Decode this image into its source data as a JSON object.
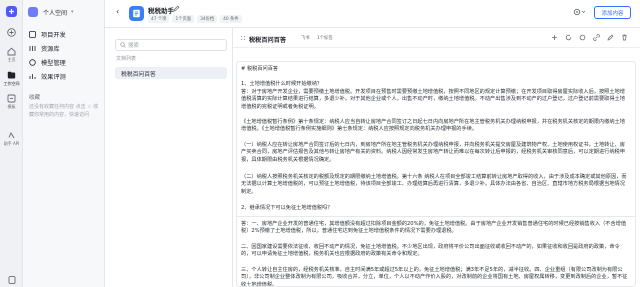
{
  "rail": {
    "items": [
      {
        "icon": "new-icon",
        "label": ""
      },
      {
        "icon": "home-icon",
        "label": "主页"
      },
      {
        "icon": "workspace-icon",
        "label": "工作空间"
      },
      {
        "icon": "settings-icon",
        "label": "模板"
      },
      {
        "icon": "chat-icon",
        "label": "助手 API"
      }
    ]
  },
  "sidebar": {
    "workspace": "个人空间",
    "items": [
      {
        "label": "项目开发"
      },
      {
        "label": "资源库"
      },
      {
        "label": "模型管理"
      },
      {
        "label": "效果评测"
      }
    ],
    "section": "收藏",
    "empty_text": "还没有收藏任何内容 点击 ☆ 收藏你常用的内容，快速访问"
  },
  "header": {
    "title": "税税助手",
    "meta": [
      "47 个项",
      "1个页面",
      "34份档",
      "40 条件"
    ],
    "add_button": "添加内容"
  },
  "filepanel": {
    "search_placeholder": "搜索",
    "list_label": "文档列表",
    "file": "税税百问百答"
  },
  "doc": {
    "title": "税税百问百答",
    "tags": [
      "飞书",
      "1个标签"
    ],
    "paragraphs": [
      "# 税税百问百答",
      "1、土地增值税什么时候开始缴纳？",
      "答：对于房地产开发企业，需要预缴土地增值税。开发项目在预售时需要预缴土地增值税，按照不同地区的规定计算预缴；在开发项目取得房屋实际收入后，按照土地增值税清算的实际计算结果进行结算，多退少补。对于其他企业或个人，出售不动产时，缴纳土地增值税。不动产出售涉及到不动产的过户登记，过户登记前需要取得土地增值税的完税证明或者免税证明。",
      "《土地增值税暂行条例》第十条规定：纳税人应当自转让房地产合同签订之日起七日内向房地产所在地主管税务机关办理纳税申报，并在税务机关核定的期限内缴纳土地增值税。《土地增值税暂行条例实施细则》第七条规定：纳税人应按照规定向税务机关办理申报的手续。",
      "（一）纳税人应在转让房地产合同签订后的七日内，到房地产所在地主管税务机关办理纳税申报，并向税务机关提交房屋及建筑物产权、土地使用权证书，土地转让、房产买卖合同，房地产评估报告及其他与转让房地产有关的资料。纳税人因经常发生房地产转让而难以在每次转让后申报的，经税务机关审核同意后，可以定期进行纳税申报，具体期限由税务机关根据情况确定。",
      "（二）纳税人按照税务机关核定的税额及规定的期限缴纳土地增值税。第十六条 纳税人在项目全部竣工结算前转让房地产取得的收入，由于涉及成本确定或其他原因，而无法据以计算土地增值税的，可以预征土地增值税，待该项目全部竣工、办理结算后再进行清算，多退少补。具体办法由各省、自治区、直辖市地方税务局根据当地情况制定。",
      "2、继承情况下可以免征土地增值税吗？",
      "答：一、房地产企业开发的普通住宅，其增值额没有超过扣除项目金额的20%的，免征土地增值税。由于房地产企业开发销售普通住宅的时候已经按销售收入（不含增值税）2%预缴了土地增值税，所以，普通住宅达到免征土地增值税条件的情况下需要办理退税。",
      "二、因国家建设需要依法征收、收回不动产的情况，免征土地增值税。不少地区出现，政府将平价公司出面征收或收回不动产的，如果征收和收回是政府的政策，命令的，可以申请免征土地增值税，税务机关也应根据政府的政策有关命令和规定。",
      "三、个人转让自主住房的，经税务机关核准，自主时间满5年或超过5年以上的，免征土地增值税；满3年不足5年的，减半征收。四、企业重组（有限公司改制为有限公司），非公司制企业整体改制为有限公司，吸收合并，分立，单位，个人以不动产作价入股的，对改制前的企业将国有土地、房屋权属转移，变更到改制后的企业，暂不征收土地增值税。"
    ]
  }
}
